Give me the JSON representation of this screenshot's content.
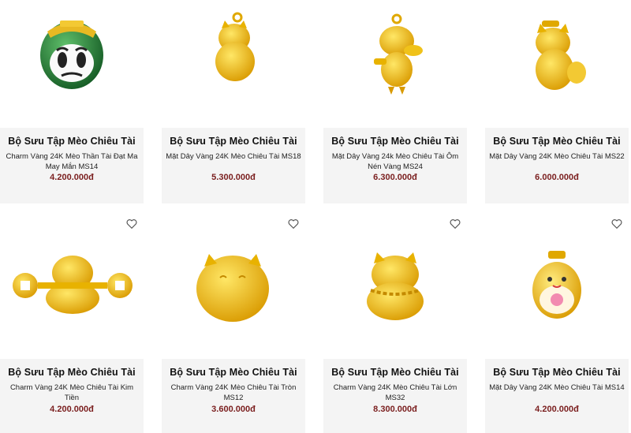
{
  "colors": {
    "card_bg": "#f4f4f4",
    "price": "#7a1e1e",
    "gold": "#f0c21a"
  },
  "products": [
    {
      "collection": "Bộ Sưu Tập Mèo Chiêu Tài",
      "name": "Charm Vàng 24K Mèo Thần Tài Đạt Ma May Mắn MS14",
      "price": "4.200.000đ",
      "icon": "green-daruma-cat-charm"
    },
    {
      "collection": "Bộ Sưu Tập Mèo Chiêu Tài",
      "name": "Mặt Dây Vàng 24K Mèo Chiêu Tài MS18",
      "price": "5.300.000đ",
      "icon": "gold-cat-pendant"
    },
    {
      "collection": "Bộ Sưu Tập Mèo Chiêu Tài",
      "name": "Mặt Dây Vàng 24k Mèo Chiêu Tài Ôm Nén Vàng MS24",
      "price": "6.300.000đ",
      "icon": "gold-cat-holding-ingot-pendant"
    },
    {
      "collection": "Bộ Sưu Tập Mèo Chiêu Tài",
      "name": "Mặt Dây Vàng 24K Mèo Chiêu Tài MS22",
      "price": "6.000.000đ",
      "icon": "gold-lucky-cat-pendant"
    },
    {
      "collection": "Bộ Sưu Tập Mèo Chiêu Tài",
      "name": "Charm Vàng 24K Mèo Chiêu Tài Kim Tiền",
      "price": "4.200.000đ",
      "icon": "gold-cat-coins-charm"
    },
    {
      "collection": "Bộ Sưu Tập Mèo Chiêu Tài",
      "name": "Charm Vàng 24K Mèo Chiêu Tài Tròn MS12",
      "price": "3.600.000đ",
      "icon": "gold-round-cat-charm"
    },
    {
      "collection": "Bộ Sưu Tập Mèo Chiêu Tài",
      "name": "Charm Vàng 24K Mèo Chiêu Tài Lớn MS32",
      "price": "8.300.000đ",
      "icon": "gold-large-cat-charm"
    },
    {
      "collection": "Bộ Sưu Tập Mèo Chiêu Tài",
      "name": "Mặt Dây Vàng 24K Mèo Chiêu Tài MS14",
      "price": "4.200.000đ",
      "icon": "enamel-flower-cat-pendant"
    }
  ]
}
